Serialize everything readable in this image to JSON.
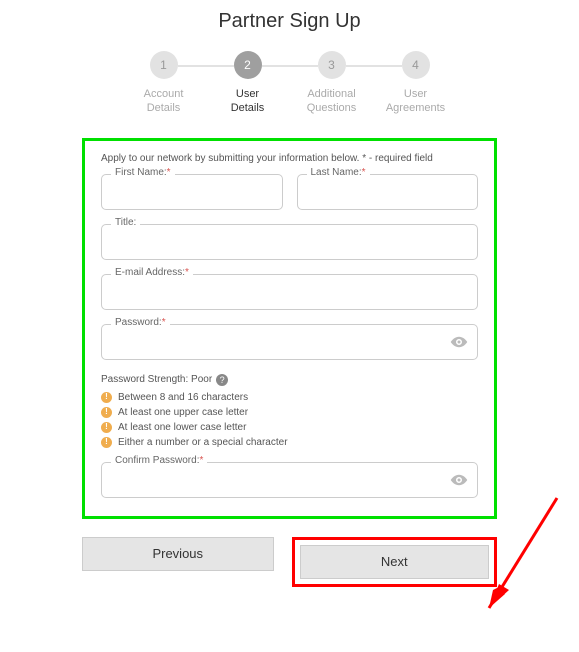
{
  "title": "Partner Sign Up",
  "steps": [
    {
      "num": "1",
      "label": "Account\nDetails"
    },
    {
      "num": "2",
      "label": "User\nDetails"
    },
    {
      "num": "3",
      "label": "Additional\nQuestions"
    },
    {
      "num": "4",
      "label": "User\nAgreements"
    }
  ],
  "instructions": "Apply to our network by submitting your information below. * - required field",
  "fields": {
    "first_name_label": "First Name:",
    "last_name_label": "Last Name:",
    "title_label": "Title:",
    "email_label": "E-mail Address:",
    "password_label": "Password:",
    "confirm_password_label": "Confirm Password:",
    "required_mark": "*"
  },
  "password_strength": {
    "label": "Password Strength: Poor",
    "help": "?",
    "rules": [
      "Between 8 and 16 characters",
      "At least one upper case letter",
      "At least one lower case letter",
      "Either a number or a special character"
    ]
  },
  "buttons": {
    "previous": "Previous",
    "next": "Next"
  }
}
